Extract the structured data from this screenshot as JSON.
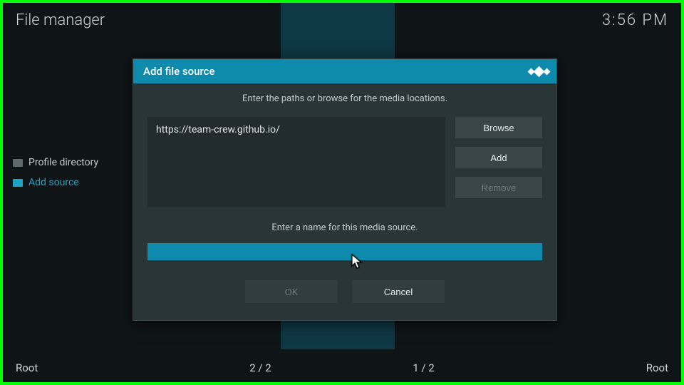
{
  "header": {
    "title": "File manager",
    "clock": "3:56 PM"
  },
  "sidebar": {
    "items": [
      {
        "label": "Profile directory",
        "active": false
      },
      {
        "label": "Add source",
        "active": true
      }
    ]
  },
  "dialog": {
    "title": "Add file source",
    "instruction_paths": "Enter the paths or browse for the media locations.",
    "path_value": "https://team-crew.github.io/",
    "buttons": {
      "browse": "Browse",
      "add": "Add",
      "remove": "Remove"
    },
    "instruction_name": "Enter a name for this media source.",
    "name_value": "",
    "ok": "OK",
    "cancel": "Cancel"
  },
  "footer": {
    "left_label": "Root",
    "left_counter": "2 / 2",
    "right_counter": "1 / 2",
    "right_label": "Root"
  },
  "colors": {
    "accent": "#0e8aad",
    "frame": "#00ff00"
  }
}
